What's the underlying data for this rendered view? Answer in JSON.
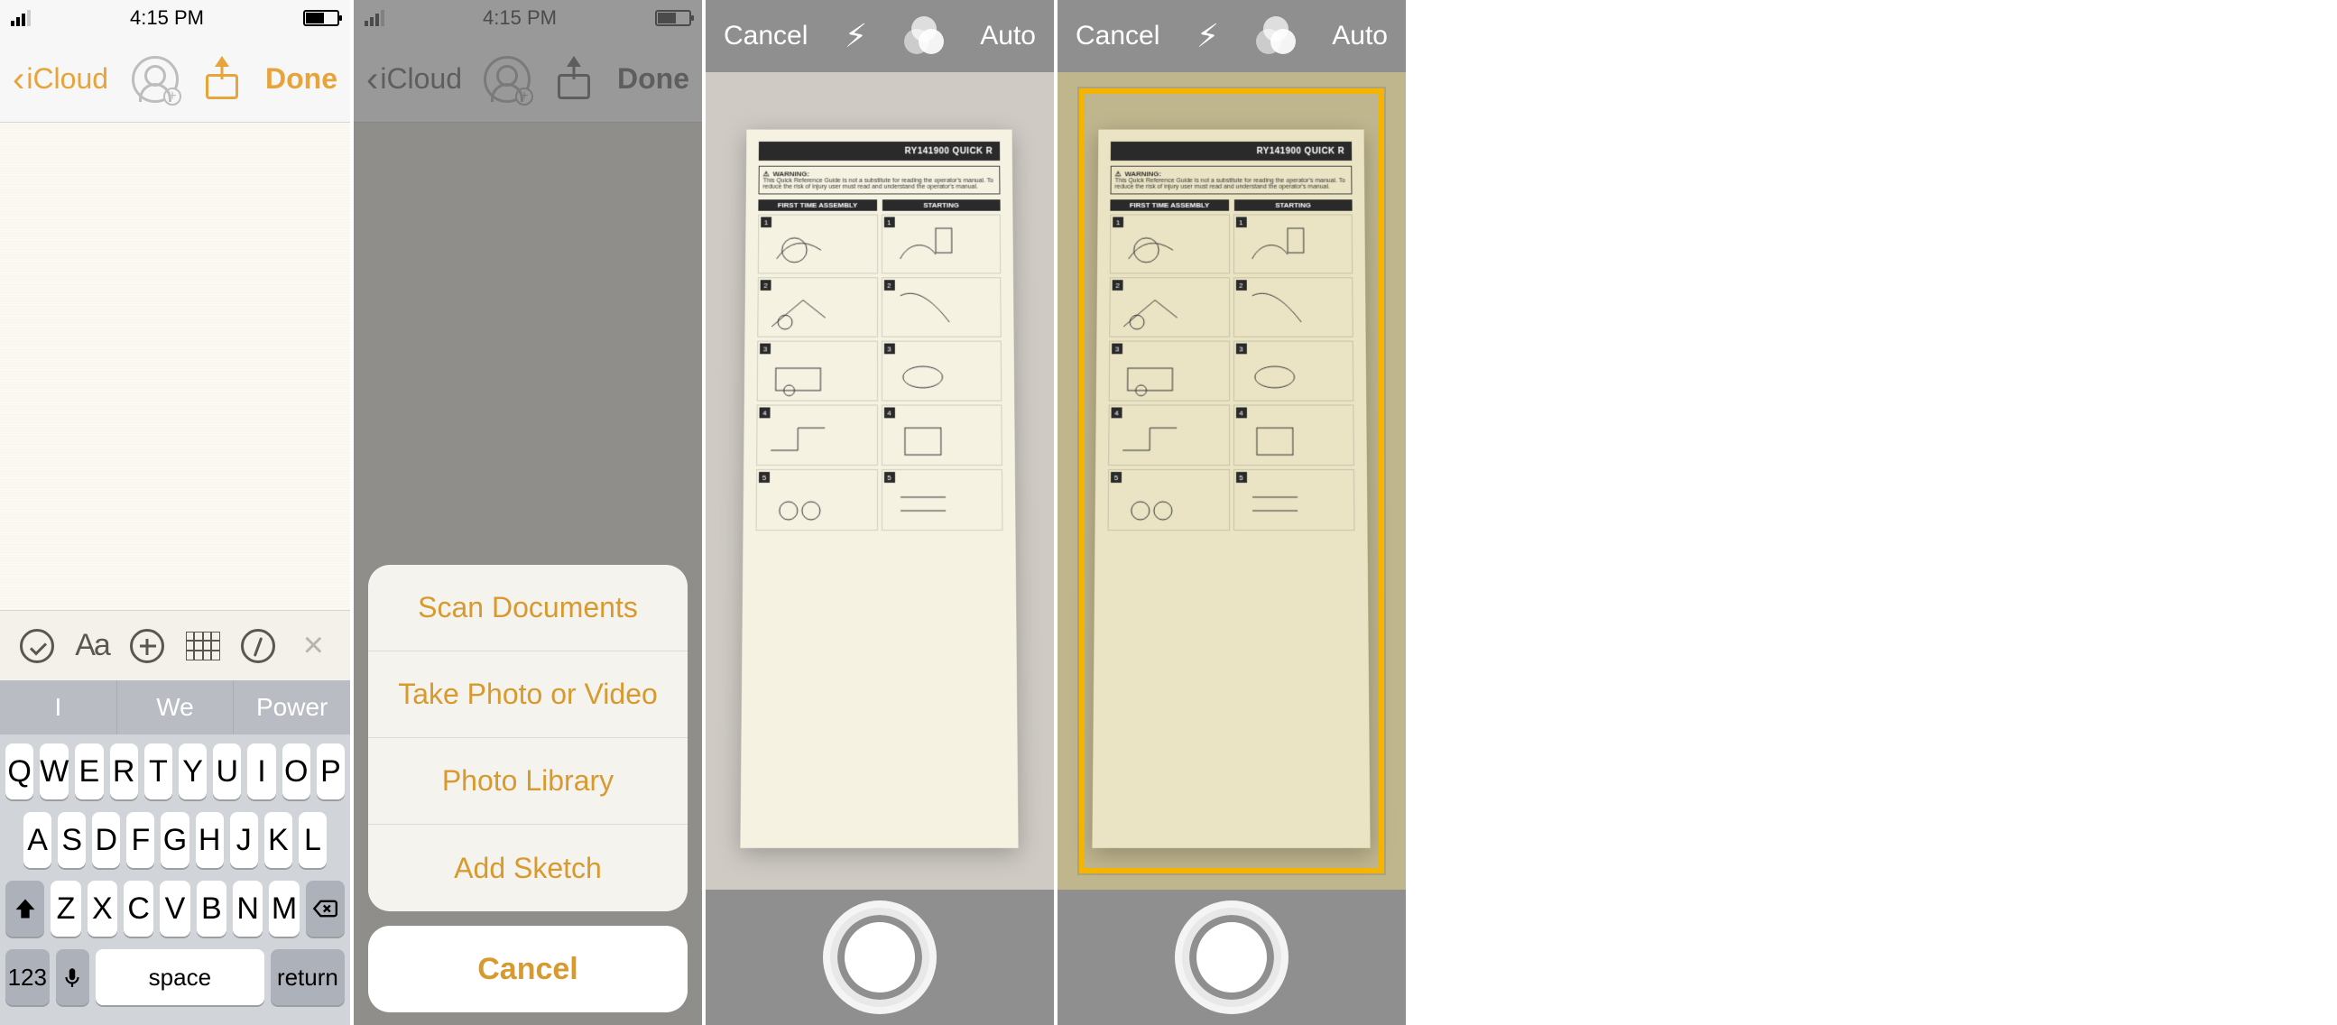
{
  "status": {
    "time": "4:15 PM"
  },
  "notes_nav": {
    "back": "iCloud",
    "done": "Done"
  },
  "toolbar": {
    "aa": "Aa"
  },
  "predictive": {
    "w1": "I",
    "w2": "We",
    "w3": "Power"
  },
  "keyboard": {
    "row1": [
      "Q",
      "W",
      "E",
      "R",
      "T",
      "Y",
      "U",
      "I",
      "O",
      "P"
    ],
    "row2": [
      "A",
      "S",
      "D",
      "F",
      "G",
      "H",
      "J",
      "K",
      "L"
    ],
    "row3": [
      "Z",
      "X",
      "C",
      "V",
      "B",
      "N",
      "M"
    ],
    "k123": "123",
    "space": "space",
    "return": "return"
  },
  "action_sheet": {
    "items": [
      "Scan Documents",
      "Take Photo or Video",
      "Photo Library",
      "Add Sketch"
    ],
    "cancel": "Cancel"
  },
  "camera": {
    "cancel": "Cancel",
    "auto": "Auto"
  },
  "document": {
    "model": "RY141900 QUICK R",
    "warning_title": "WARNING:",
    "warning_text": "This Quick Reference Guide is not a substitute for reading the operator's manual. To reduce the risk of injury user must read and understand the operator's manual.",
    "section1": "FIRST TIME ASSEMBLY",
    "section2": "STARTING"
  }
}
